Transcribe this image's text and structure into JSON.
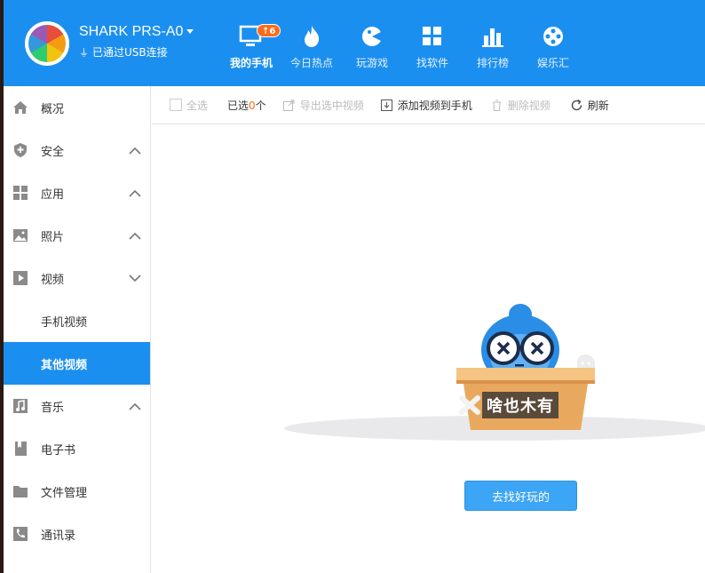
{
  "header": {
    "device_name": "SHARK PRS-A0",
    "connection_status": "已通过USB连接",
    "nav": [
      {
        "label": "我的手机",
        "icon": "phone-icon",
        "badge": "↑6",
        "active": true
      },
      {
        "label": "今日热点",
        "icon": "flame-icon"
      },
      {
        "label": "玩游戏",
        "icon": "game-icon"
      },
      {
        "label": "找软件",
        "icon": "apps-icon"
      },
      {
        "label": "排行榜",
        "icon": "chart-icon"
      },
      {
        "label": "娱乐汇",
        "icon": "film-reel-icon"
      }
    ]
  },
  "sidebar": {
    "items": [
      {
        "label": "概况",
        "icon": "home-icon"
      },
      {
        "label": "安全",
        "icon": "shield-icon",
        "expanded": false
      },
      {
        "label": "应用",
        "icon": "grid-icon",
        "expanded": false
      },
      {
        "label": "照片",
        "icon": "image-icon",
        "expanded": false
      },
      {
        "label": "视频",
        "icon": "play-icon",
        "expanded": true
      },
      {
        "label": "手机视频",
        "sub": true
      },
      {
        "label": "其他视频",
        "sub": true,
        "selected": true
      },
      {
        "label": "音乐",
        "icon": "music-icon",
        "expanded": false
      },
      {
        "label": "电子书",
        "icon": "book-icon"
      },
      {
        "label": "文件管理",
        "icon": "folder-icon"
      },
      {
        "label": "通讯录",
        "icon": "contacts-icon"
      }
    ]
  },
  "toolbar": {
    "select_all": "全选",
    "selected_prefix": "已选",
    "selected_count": "0",
    "selected_suffix": "个",
    "export": "导出选中视频",
    "add": "添加视频到手机",
    "delete": "删除视频",
    "refresh": "刷新"
  },
  "empty_state": {
    "message": "啥也木有",
    "button": "去找好玩的"
  },
  "colors": {
    "brand": "#1b8ff0",
    "accent": "#ff6a1a",
    "button": "#3da5f5"
  }
}
